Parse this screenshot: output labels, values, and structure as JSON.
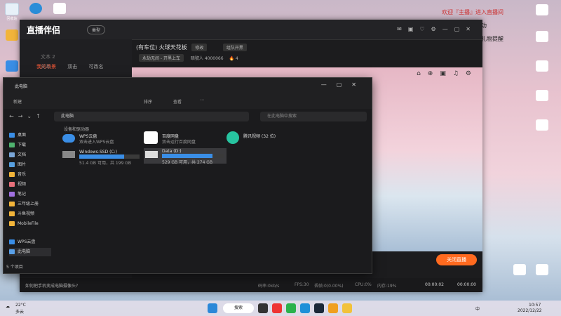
{
  "desktop": {
    "icons": [
      "回收站",
      "",
      "",
      "",
      "",
      "",
      "",
      "",
      "",
      "",
      ""
    ],
    "left_icons": [
      "回收站",
      "",
      "",
      "",
      ""
    ],
    "right_icons": [
      "",
      "",
      "",
      "",
      "",
      ""
    ]
  },
  "streamer": {
    "logo": "直播伴侣",
    "type_label": "类型",
    "tabs": [
      "我的场景",
      "双击",
      "可改名"
    ],
    "scenes": [
      "文本 2",
      "文本"
    ],
    "room_title": "(有车位) 火球天花板",
    "edit_btn": "修改",
    "pin_btn": "组队开黑",
    "status": "永劫无间 - 开黑上车",
    "viewers_label": "暗號人",
    "viewers": "4000066",
    "likes": "4",
    "stop_btn": "关闭直播",
    "bottom_tip": "如何把手机变成电脑摄像头?",
    "stats": [
      "码率:0kb/s",
      "FPS:30",
      "丢帧:0(0.00%)",
      "CPU:0%",
      "内存:19%"
    ],
    "time1": "00:00:02",
    "time2": "00:00:00"
  },
  "explorer": {
    "tab_title": "此电脑",
    "cmd_new": "新建",
    "cmd_sort": "排序",
    "cmd_view": "查看",
    "address": "此电脑",
    "search_placeholder": "在此电脑中搜索",
    "section_title": "设备和驱动器",
    "nav_items": [
      "桌面",
      "下载",
      "文档",
      "图片",
      "音乐",
      "视频",
      "笔记",
      "三年级上册",
      "斗鱼视频",
      "MobileFile",
      "WPS云盘",
      "此电脑"
    ],
    "drives": [
      {
        "name": "WPS云盘",
        "sub": "双击进入WPS云盘"
      },
      {
        "name": "百度网盘",
        "sub": "双击运行百度网盘"
      },
      {
        "name": "腾讯视频 (32 位)",
        "sub": ""
      },
      {
        "name": "Windows-SSD (C:)",
        "sub": "51.4 GB 可用，共 199 GB",
        "fill": 0.74
      },
      {
        "name": "Data (D:)",
        "sub": "529 GB 可用，共 274 GB",
        "fill": 0.82
      }
    ],
    "status": "5 个项目"
  },
  "chat": {
    "lines": [
      "欢迎『主播』进入直播间",
      "添加弹幕助手成功",
      "点菜单可设置小礼物提醒"
    ]
  },
  "taskbar": {
    "weather": "22°C",
    "weather_sub": "多云",
    "search": "搜索",
    "lang": "中",
    "time": "10:57",
    "date": "2022/12/22"
  }
}
